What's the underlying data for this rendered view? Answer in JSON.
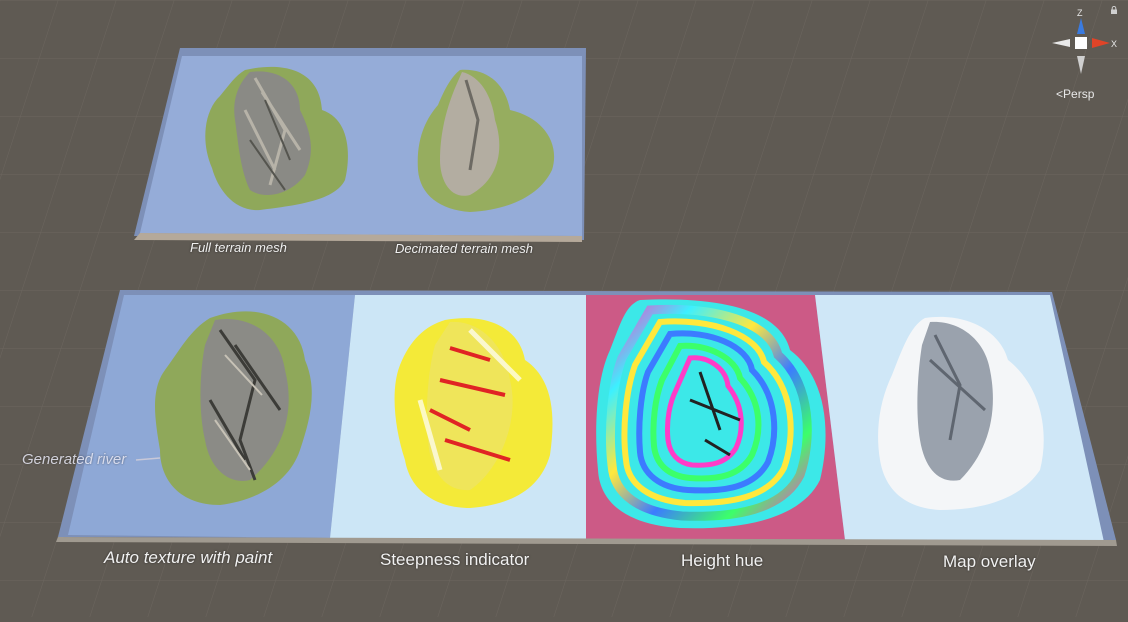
{
  "viewport": {
    "projection_label": "Persp",
    "gizmo_axes": [
      "Z",
      "X"
    ]
  },
  "panels_top": [
    {
      "label": "Full terrain mesh"
    },
    {
      "label": "Decimated terrain mesh"
    }
  ],
  "panels_bottom": [
    {
      "label": "Auto texture with paint"
    },
    {
      "label": "Steepness indicator"
    },
    {
      "label": "Height hue"
    },
    {
      "label": "Map overlay"
    }
  ],
  "annotations": {
    "river": "Generated river"
  },
  "colors": {
    "background": "#5f5a53",
    "water": "#8ea8d6",
    "grass": "#8fa85a",
    "rock": "#8c8c8c",
    "steep_highlight": "#f4ea38",
    "steep_red": "#e02424",
    "hue_background": "#cc5a86",
    "axis_z": "#3a7be0",
    "axis_x": "#e04428"
  }
}
